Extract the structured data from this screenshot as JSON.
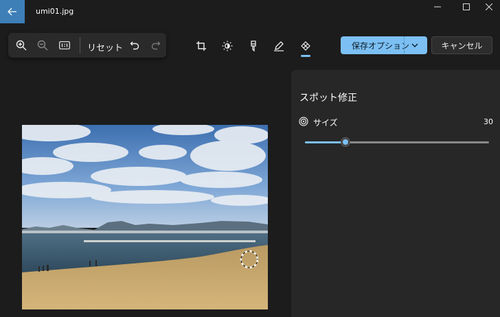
{
  "window": {
    "filename": "umi01.jpg"
  },
  "toolbar": {
    "reset_label": "リセット",
    "icons": [
      "zoom-in-icon",
      "zoom-out-icon",
      "actual-size-icon",
      "undo-icon",
      "redo-icon"
    ],
    "tools": [
      "crop-icon",
      "adjust-icon",
      "filter-icon",
      "markup-icon",
      "spot-fix-icon"
    ],
    "active_tool": "spot-fix-icon"
  },
  "actions": {
    "save_label": "保存オプション",
    "cancel_label": "キャンセル"
  },
  "panel": {
    "title": "スポット修正",
    "size_label": "サイズ",
    "size_value": "30",
    "slider_fraction": 0.22
  },
  "colors": {
    "accent": "#7cc0f3",
    "back_button": "#3e7fb8",
    "background": "#1c1c1c",
    "panel": "#272727"
  }
}
